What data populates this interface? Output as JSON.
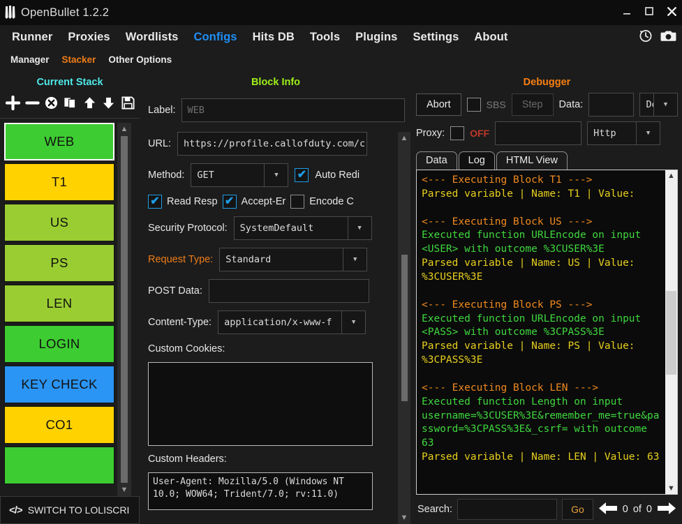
{
  "window": {
    "title": "OpenBullet 1.2.2",
    "minimize": "—",
    "maximize": "❐",
    "close": "✕"
  },
  "menu": {
    "items": [
      {
        "label": "Runner",
        "active": false
      },
      {
        "label": "Proxies",
        "active": false
      },
      {
        "label": "Wordlists",
        "active": false
      },
      {
        "label": "Configs",
        "active": true
      },
      {
        "label": "Hits DB",
        "active": false
      },
      {
        "label": "Tools",
        "active": false
      },
      {
        "label": "Plugins",
        "active": false
      },
      {
        "label": "Settings",
        "active": false
      },
      {
        "label": "About",
        "active": false
      }
    ],
    "icons": [
      "clock-history-icon",
      "camera-icon"
    ]
  },
  "submenu": {
    "items": [
      {
        "label": "Manager",
        "active": false
      },
      {
        "label": "Stacker",
        "active": true
      },
      {
        "label": "Other Options",
        "active": false
      }
    ]
  },
  "stack": {
    "title": "Current Stack",
    "toolbar": [
      {
        "name": "add-block-button",
        "glyph": "+"
      },
      {
        "name": "remove-block-button",
        "glyph": "−"
      },
      {
        "name": "delete-block-button",
        "glyph": "⊗"
      },
      {
        "name": "clone-block-button",
        "glyph": "❐"
      },
      {
        "name": "move-up-button",
        "glyph": "⬆"
      },
      {
        "name": "move-down-button",
        "glyph": "⬇"
      },
      {
        "name": "save-stack-button",
        "glyph": "💾"
      }
    ],
    "blocks": [
      {
        "label": "WEB",
        "color": "#3DCC31",
        "selected": true
      },
      {
        "label": "T1",
        "color": "#FFD200",
        "selected": false
      },
      {
        "label": "US",
        "color": "#9ACD32",
        "selected": false
      },
      {
        "label": "PS",
        "color": "#9ACD32",
        "selected": false
      },
      {
        "label": "LEN",
        "color": "#9ACD32",
        "selected": false
      },
      {
        "label": "LOGIN",
        "color": "#3DCC31",
        "selected": false
      },
      {
        "label": "KEY CHECK",
        "color": "#2B95F5",
        "selected": false
      },
      {
        "label": "CO1",
        "color": "#FFD200",
        "selected": false
      },
      {
        "label": "",
        "color": "#3DCC31",
        "selected": false
      }
    ],
    "switch_button": "SWITCH TO LOLISCRI"
  },
  "block_info": {
    "title": "Block Info",
    "label_caption": "Label:",
    "label_value": "WEB",
    "url_caption": "URL:",
    "url_value": "https://profile.callofduty.com/c",
    "method_caption": "Method:",
    "method_value": "GET",
    "auto_redirect_label": "Auto Redi",
    "auto_redirect_checked": true,
    "read_response_label": "Read Resp",
    "read_response_checked": true,
    "accept_encoding_label": "Accept-Er",
    "accept_encoding_checked": true,
    "encode_content_label": "Encode C",
    "encode_content_checked": false,
    "security_protocol_caption": "Security Protocol:",
    "security_protocol_value": "SystemDefault",
    "request_type_caption": "Request Type:",
    "request_type_value": "Standard",
    "post_data_caption": "POST Data:",
    "post_data_value": "",
    "content_type_caption": "Content-Type:",
    "content_type_value": "application/x-www-f",
    "custom_cookies_caption": "Custom Cookies:",
    "custom_cookies_value": "",
    "custom_headers_caption": "Custom Headers:",
    "custom_headers_value": "User-Agent: Mozilla/5.0 (Windows NT 10.0; WOW64; Trident/7.0; rv:11.0)"
  },
  "debugger": {
    "title": "Debugger",
    "abort_label": "Abort",
    "sbs_label": "SBS",
    "sbs_checked": false,
    "step_label": "Step",
    "data_caption": "Data:",
    "data_value": "",
    "data_type_value": "De",
    "proxy_caption": "Proxy:",
    "proxy_checked": false,
    "proxy_state": "OFF",
    "proxy_value": "",
    "proxy_type_value": "Http",
    "tabs": [
      {
        "label": "Data",
        "active": false
      },
      {
        "label": "Log",
        "active": true
      },
      {
        "label": "HTML View",
        "active": false
      }
    ],
    "log_lines": [
      {
        "text": "<--- Executing Block T1 --->",
        "type": "exec"
      },
      {
        "text": "Parsed variable | Name: T1 | Value: ",
        "type": "var"
      },
      {
        "text": "",
        "type": "blank"
      },
      {
        "text": "<--- Executing Block US --->",
        "type": "exec"
      },
      {
        "text": "Executed function URLEncode on input <USER> with outcome %3CUSER%3E",
        "type": "fn"
      },
      {
        "text": "Parsed variable | Name: US | Value: %3CUSER%3E",
        "type": "var"
      },
      {
        "text": "",
        "type": "blank"
      },
      {
        "text": "<--- Executing Block PS --->",
        "type": "exec"
      },
      {
        "text": "Executed function URLEncode on input <PASS> with outcome %3CPASS%3E",
        "type": "fn"
      },
      {
        "text": "Parsed variable | Name: PS | Value: %3CPASS%3E",
        "type": "var"
      },
      {
        "text": "",
        "type": "blank"
      },
      {
        "text": "<--- Executing Block LEN --->",
        "type": "exec"
      },
      {
        "text": "Executed function Length on input username=%3CUSER%3E&remember_me=true&password=%3CPASS%3E&_csrf= with outcome 63",
        "type": "fn"
      },
      {
        "text": "Parsed variable | Name: LEN | Value: 63",
        "type": "var"
      }
    ],
    "search_caption": "Search:",
    "search_value": "",
    "go_label": "Go",
    "match_current": "0",
    "match_of": "of",
    "match_total": "0"
  }
}
